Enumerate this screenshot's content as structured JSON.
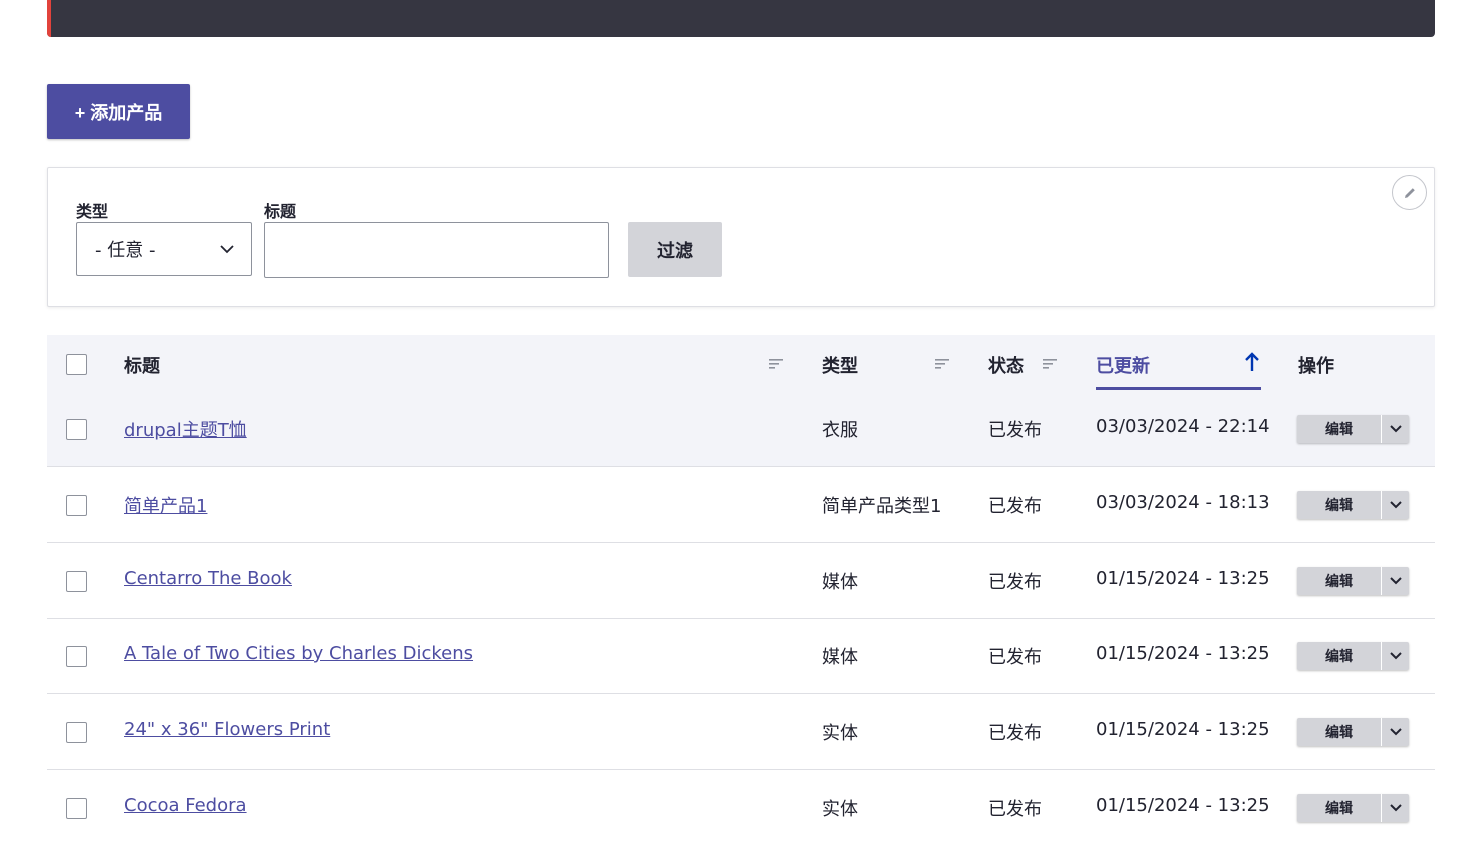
{
  "toolbar": {
    "add_product_label": "+ 添加产品"
  },
  "filters": {
    "type_label": "类型",
    "type_selected": "- 任意 -",
    "title_label": "标题",
    "title_value": "",
    "filter_button": "过滤"
  },
  "table": {
    "headers": {
      "title": "标题",
      "type": "类型",
      "status": "状态",
      "updated": "已更新",
      "actions": "操作"
    },
    "sorted_by": "已更新",
    "rows": [
      {
        "title": "drupal主题T恤",
        "type": "衣服",
        "status": "已发布",
        "updated": "03/03/2024 - 22:14",
        "action": "编辑"
      },
      {
        "title": "简单产品1",
        "type": "简单产品类型1",
        "status": "已发布",
        "updated": "03/03/2024 - 18:13",
        "action": "编辑"
      },
      {
        "title": "Centarro The Book",
        "type": "媒体",
        "status": "已发布",
        "updated": "01/15/2024 - 13:25",
        "action": "编辑"
      },
      {
        "title": "A Tale of Two Cities by Charles Dickens",
        "type": "媒体",
        "status": "已发布",
        "updated": "01/15/2024 - 13:25",
        "action": "编辑"
      },
      {
        "title": "24\" x 36\" Flowers Print",
        "type": "实体",
        "status": "已发布",
        "updated": "01/15/2024 - 13:25",
        "action": "编辑"
      },
      {
        "title": "Cocoa Fedora",
        "type": "实体",
        "status": "已发布",
        "updated": "01/15/2024 - 13:25",
        "action": "编辑"
      }
    ]
  },
  "colors": {
    "primary": "#4d4da1",
    "header_bg": "#f3f4f9",
    "topbar": "#363641",
    "accent": "#e2433c"
  }
}
